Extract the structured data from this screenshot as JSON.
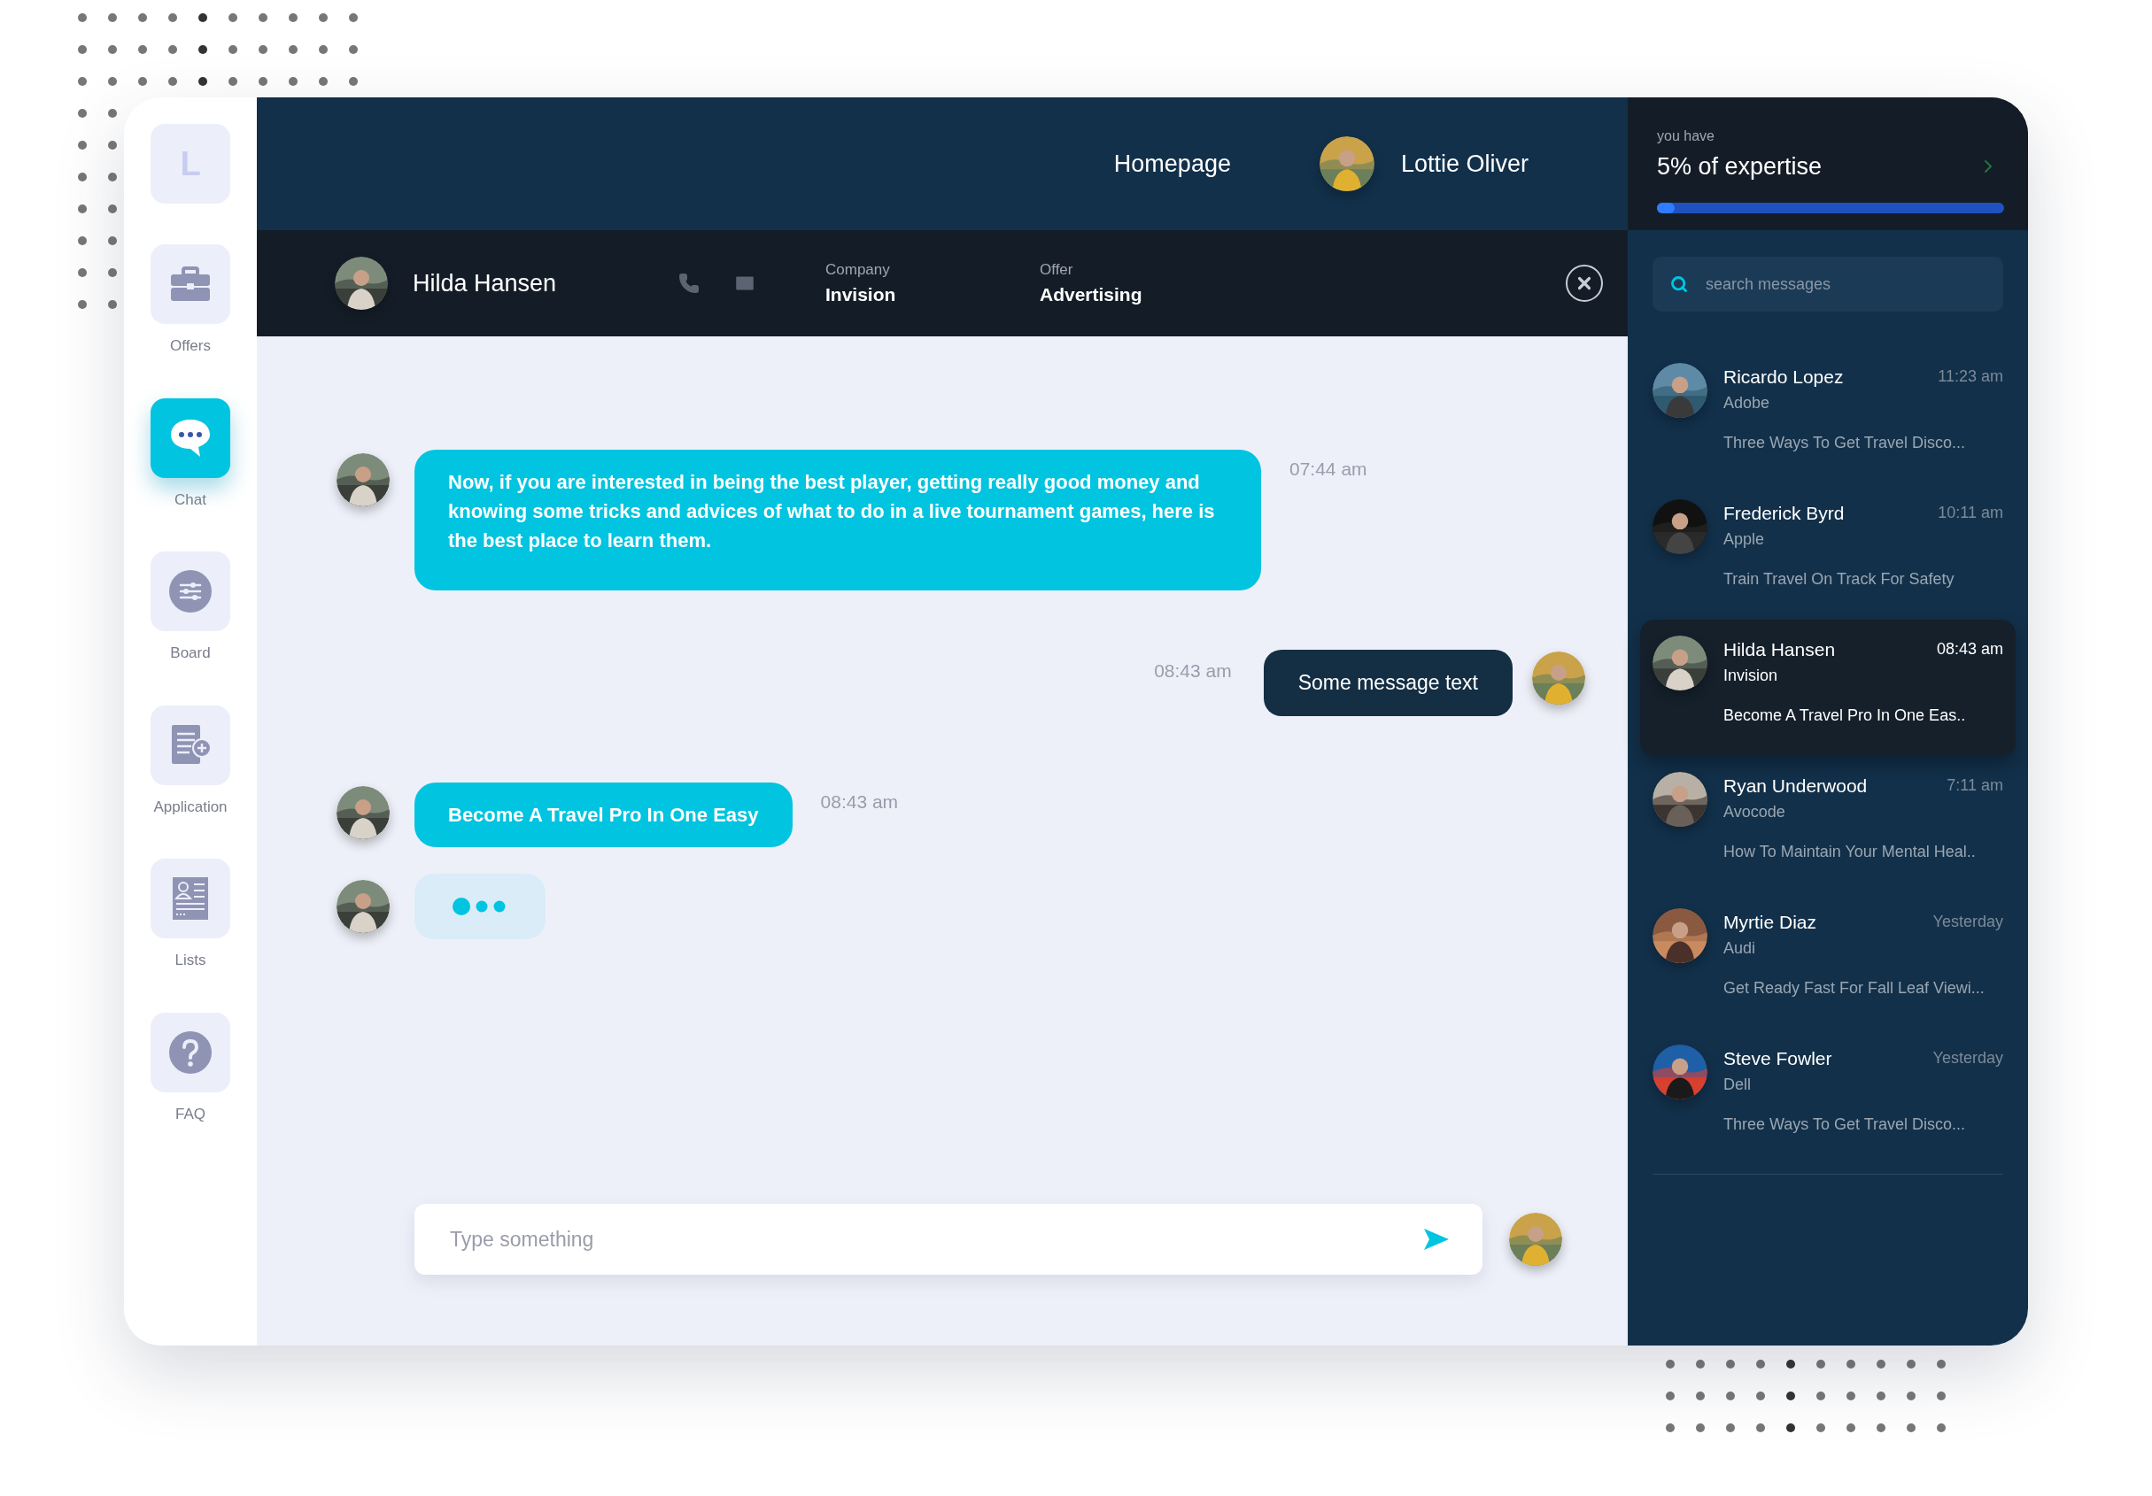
{
  "sidebar": {
    "logo_letter": "L",
    "items": [
      {
        "kind": "offers",
        "label": "Offers",
        "selected": false
      },
      {
        "kind": "chat",
        "label": "Chat",
        "selected": true
      },
      {
        "kind": "board",
        "label": "Board",
        "selected": false
      },
      {
        "kind": "application",
        "label": "Application",
        "selected": false
      },
      {
        "kind": "lists",
        "label": "Lists",
        "selected": false
      },
      {
        "kind": "faq",
        "label": "FAQ",
        "selected": false
      }
    ]
  },
  "header": {
    "nav_link": "Homepage",
    "user_name": "Lottie Oliver"
  },
  "contact_bar": {
    "name": "Hilda Hansen",
    "fields": [
      {
        "label": "Company",
        "value": "Invision"
      },
      {
        "label": "Offer",
        "value": "Advertising"
      }
    ]
  },
  "messages": [
    {
      "kind": "incoming",
      "text": "Now, if you are interested in being the best player, getting really good money and knowing some tricks and advices of what to do in a live tournament games, here is the best place to learn them.",
      "time": "07:44 am"
    },
    {
      "kind": "outgoing",
      "text": "Some message text",
      "time": "08:43 am"
    },
    {
      "kind": "incoming",
      "text": "Become A Travel Pro In One Easy",
      "time": "08:43 am"
    },
    {
      "kind": "typing"
    }
  ],
  "composer": {
    "placeholder": "Type something"
  },
  "expertise": {
    "caption": "you have",
    "title": "5% of expertise",
    "level": 0.05
  },
  "search": {
    "placeholder": "search messages"
  },
  "conversations": [
    {
      "name": "Ricardo Lopez",
      "company": "Adobe",
      "time": "11:23 am",
      "preview": "Three Ways To Get Travel Disco...",
      "selected": false
    },
    {
      "name": "Frederick Byrd",
      "company": "Apple",
      "time": "10:11 am",
      "preview": "Train Travel On Track For Safety",
      "selected": false
    },
    {
      "name": "Hilda Hansen",
      "company": "Invision",
      "time": "08:43 am",
      "preview": "Become A Travel Pro In One Eas..",
      "selected": true
    },
    {
      "name": "Ryan Underwood",
      "company": "Avocode",
      "time": "7:11 am",
      "preview": "How To Maintain Your Mental Heal..",
      "selected": false
    },
    {
      "name": "Myrtie Diaz",
      "company": "Audi",
      "time": "Yesterday",
      "preview": "Get Ready Fast For Fall Leaf Viewi...",
      "selected": false
    },
    {
      "name": "Steve Fowler",
      "company": "Dell",
      "time": "Yesterday",
      "preview": "Three Ways To Get Travel Disco...",
      "selected": false
    }
  ]
}
